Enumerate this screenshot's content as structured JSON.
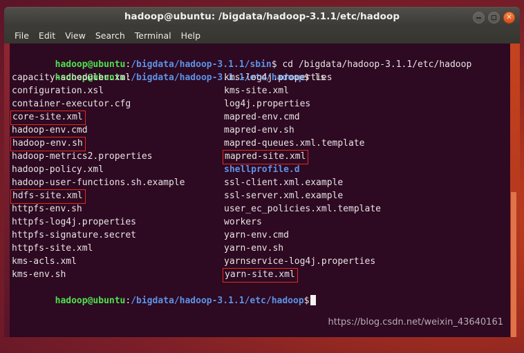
{
  "window": {
    "title": "hadoop@ubuntu: /bigdata/hadoop-3.1.1/etc/hadoop",
    "controls": {
      "minimize": "minimize",
      "maximize": "maximize",
      "close": "close"
    }
  },
  "menubar": {
    "items": [
      {
        "label": "File"
      },
      {
        "label": "Edit"
      },
      {
        "label": "View"
      },
      {
        "label": "Search"
      },
      {
        "label": "Terminal"
      },
      {
        "label": "Help"
      }
    ]
  },
  "terminal": {
    "prompt_1": {
      "user_host": "hadoop@ubuntu",
      "colon": ":",
      "path": "/bigdata/hadoop-3.1.1/sbin",
      "dollar": "$",
      "command": " cd /bigdata/hadoop-3.1.1/etc/hadoop"
    },
    "prompt_2": {
      "user_host": "hadoop@ubuntu",
      "colon": ":",
      "path": "/bigdata/hadoop-3.1.1/etc/hadoop",
      "dollar": "$",
      "command": " ls"
    },
    "prompt_3": {
      "user_host": "hadoop@ubuntu",
      "colon": ":",
      "path": "/bigdata/hadoop-3.1.1/etc/hadoop",
      "dollar": "$",
      "command": ""
    },
    "listing": [
      {
        "left": "capacity-scheduler.xml",
        "left_boxed": false,
        "left_dir": false,
        "right": "kms-log4j.properties",
        "right_boxed": false,
        "right_dir": false
      },
      {
        "left": "configuration.xsl",
        "left_boxed": false,
        "left_dir": false,
        "right": "kms-site.xml",
        "right_boxed": false,
        "right_dir": false
      },
      {
        "left": "container-executor.cfg",
        "left_boxed": false,
        "left_dir": false,
        "right": "log4j.properties",
        "right_boxed": false,
        "right_dir": false
      },
      {
        "left": "core-site.xml",
        "left_boxed": true,
        "left_dir": false,
        "right": "mapred-env.cmd",
        "right_boxed": false,
        "right_dir": false
      },
      {
        "left": "hadoop-env.cmd",
        "left_boxed": false,
        "left_dir": false,
        "right": "mapred-env.sh",
        "right_boxed": false,
        "right_dir": false
      },
      {
        "left": "hadoop-env.sh",
        "left_boxed": true,
        "left_dir": false,
        "right": "mapred-queues.xml.template",
        "right_boxed": false,
        "right_dir": false
      },
      {
        "left": "hadoop-metrics2.properties",
        "left_boxed": false,
        "left_dir": false,
        "right": "mapred-site.xml",
        "right_boxed": true,
        "right_dir": false
      },
      {
        "left": "hadoop-policy.xml",
        "left_boxed": false,
        "left_dir": false,
        "right": "shellprofile.d",
        "right_boxed": false,
        "right_dir": true
      },
      {
        "left": "hadoop-user-functions.sh.example",
        "left_boxed": false,
        "left_dir": false,
        "right": "ssl-client.xml.example",
        "right_boxed": false,
        "right_dir": false
      },
      {
        "left": "hdfs-site.xml",
        "left_boxed": true,
        "left_dir": false,
        "right": "ssl-server.xml.example",
        "right_boxed": false,
        "right_dir": false
      },
      {
        "left": "httpfs-env.sh",
        "left_boxed": false,
        "left_dir": false,
        "right": "user_ec_policies.xml.template",
        "right_boxed": false,
        "right_dir": false
      },
      {
        "left": "httpfs-log4j.properties",
        "left_boxed": false,
        "left_dir": false,
        "right": "workers",
        "right_boxed": false,
        "right_dir": false
      },
      {
        "left": "httpfs-signature.secret",
        "left_boxed": false,
        "left_dir": false,
        "right": "yarn-env.cmd",
        "right_boxed": false,
        "right_dir": false
      },
      {
        "left": "httpfs-site.xml",
        "left_boxed": false,
        "left_dir": false,
        "right": "yarn-env.sh",
        "right_boxed": false,
        "right_dir": false
      },
      {
        "left": "kms-acls.xml",
        "left_boxed": false,
        "left_dir": false,
        "right": "yarnservice-log4j.properties",
        "right_boxed": false,
        "right_dir": false
      },
      {
        "left": "kms-env.sh",
        "left_boxed": false,
        "left_dir": false,
        "right": "yarn-site.xml",
        "right_boxed": true,
        "right_dir": false
      }
    ]
  },
  "watermark": {
    "text": "https://blog.csdn.net/weixin_43640161"
  },
  "colors": {
    "terminal_bg": "#2d0922",
    "prompt_green": "#4ee24e",
    "path_blue": "#5d93e6",
    "text_white": "#e8e4e2",
    "highlight_red": "#e82a1b",
    "close_orange": "#dc4a16"
  }
}
